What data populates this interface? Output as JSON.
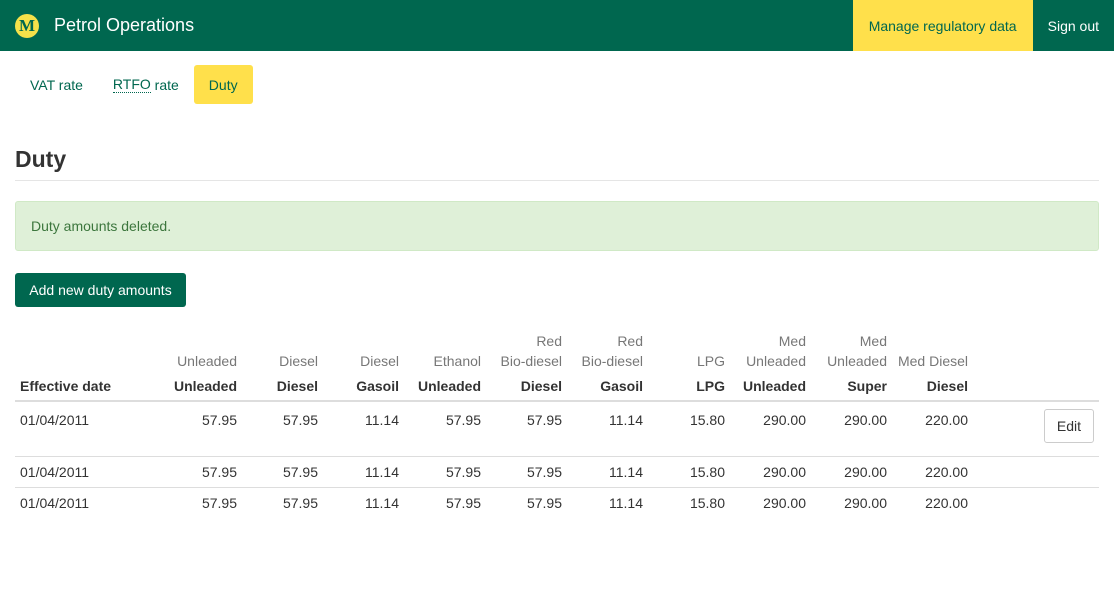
{
  "header": {
    "logo_letter": "M",
    "app_title": "Petrol Operations",
    "manage_label": "Manage regulatory data",
    "signout_label": "Sign out"
  },
  "subnav": {
    "tabs": [
      {
        "label": "VAT rate",
        "active": false
      },
      {
        "label": "RTFO",
        "suffix": " rate",
        "active": false
      },
      {
        "label": "Duty",
        "active": true
      }
    ]
  },
  "page": {
    "title": "Duty",
    "alert": "Duty amounts deleted.",
    "add_button": "Add new duty amounts"
  },
  "table": {
    "columns": [
      {
        "top": "",
        "main": "Effective date"
      },
      {
        "top": "Unleaded",
        "main": "Unleaded"
      },
      {
        "top": "Diesel",
        "main": "Diesel"
      },
      {
        "top": "Diesel",
        "main": "Gasoil"
      },
      {
        "top": "Ethanol",
        "main": "Unleaded"
      },
      {
        "top": "Red|Bio-diesel",
        "main": "Diesel"
      },
      {
        "top": "Red|Bio-diesel",
        "main": "Gasoil"
      },
      {
        "top": "LPG",
        "main": "LPG"
      },
      {
        "top": "Med|Unleaded",
        "main": "Unleaded"
      },
      {
        "top": "Med|Unleaded",
        "main": "Super"
      },
      {
        "top": "Med Diesel",
        "main": "Diesel"
      }
    ],
    "rows": [
      [
        "01/04/2011",
        "57.95",
        "57.95",
        "11.14",
        "57.95",
        "57.95",
        "11.14",
        "15.80",
        "290.00",
        "290.00",
        "220.00"
      ],
      [
        "01/04/2011",
        "57.95",
        "57.95",
        "11.14",
        "57.95",
        "57.95",
        "11.14",
        "15.80",
        "290.00",
        "290.00",
        "220.00"
      ],
      [
        "01/04/2011",
        "57.95",
        "57.95",
        "11.14",
        "57.95",
        "57.95",
        "11.14",
        "15.80",
        "290.00",
        "290.00",
        "220.00"
      ]
    ],
    "edit_label": "Edit"
  }
}
